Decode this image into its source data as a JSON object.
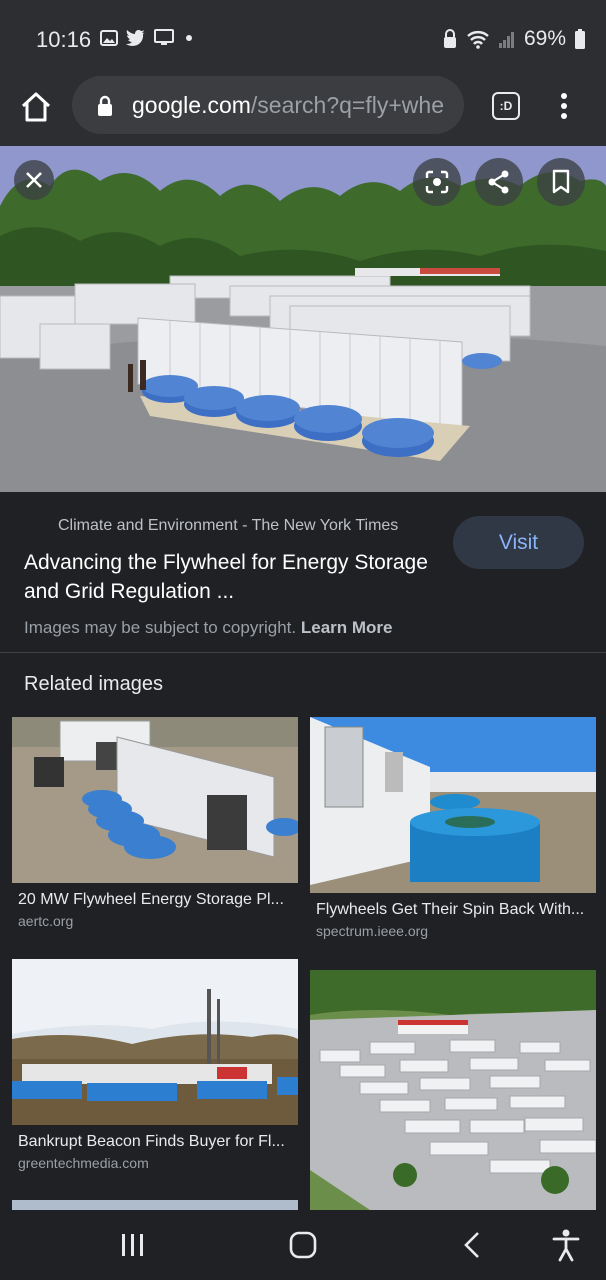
{
  "status_bar": {
    "time": "10:16",
    "battery_percent": "69%"
  },
  "address_bar": {
    "url_host": "google.com",
    "url_path": "/search?q=fly+whe",
    "tabs_label": ":D"
  },
  "image_detail": {
    "source": "Climate and Environment - The New York Times",
    "title": "Advancing the Flywheel for Energy Storage and Grid Regulation ...",
    "visit_label": "Visit",
    "copyright_text": "Images may be subject to copyright.",
    "learn_more_label": "Learn More"
  },
  "related": {
    "heading": "Related images",
    "items": [
      {
        "title": "20 MW Flywheel Energy Storage Pl...",
        "site": "aertc.org"
      },
      {
        "title": "Flywheels Get Their Spin Back With...",
        "site": "spectrum.ieee.org"
      },
      {
        "title": "Bankrupt Beacon Finds Buyer for Fl...",
        "site": "greentechmedia.com"
      },
      {
        "title": "",
        "site": ""
      }
    ]
  },
  "colors": {
    "background": "#202124",
    "accent": "#8ab4f8",
    "container_blue": "#3d6fc4"
  }
}
